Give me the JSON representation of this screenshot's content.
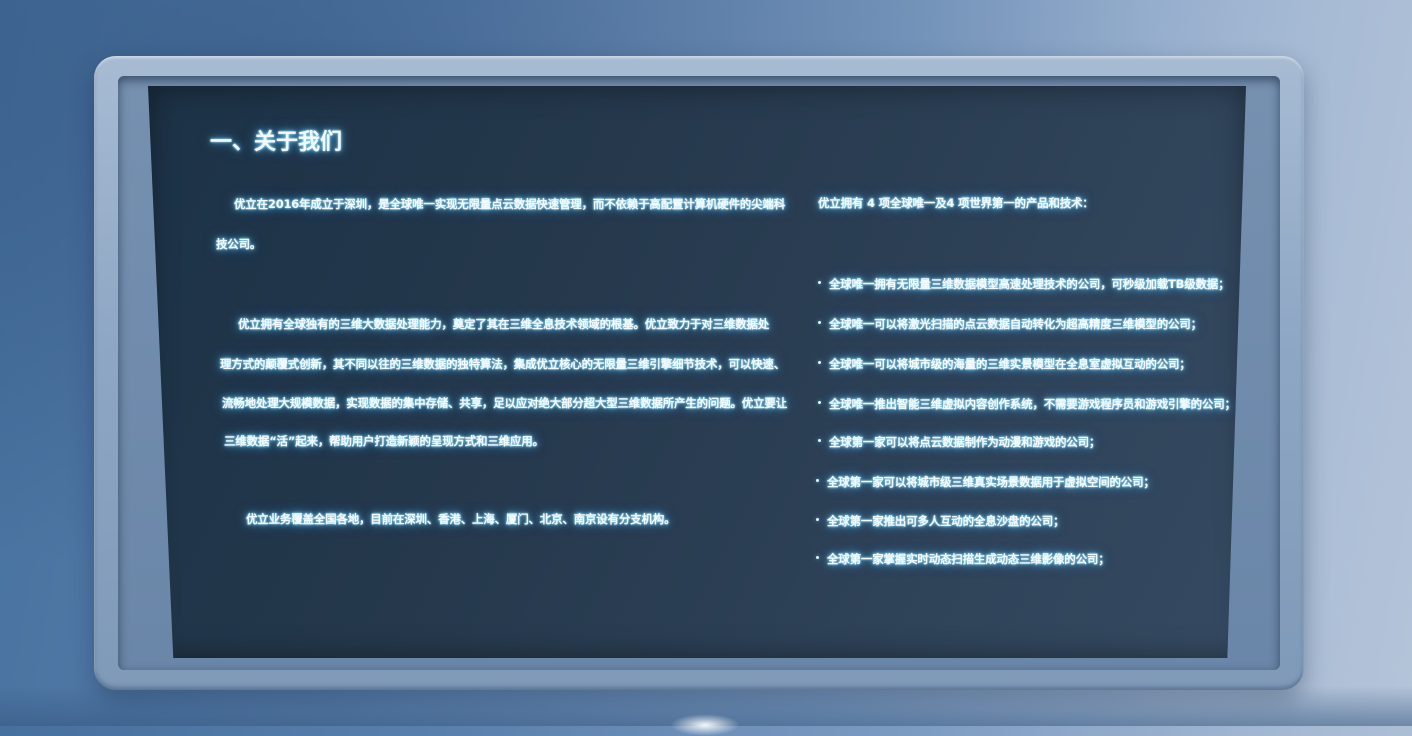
{
  "board": {
    "title": "一、关于我们",
    "left_lines": [
      "优立在2016年成立于深圳，是全球唯一实现无限量点云数据快速管理，而不依赖于高配置计算机硬件的尖端科",
      "技公司。",
      "优立拥有全球独有的三维大数据处理能力，奠定了其在三维全息技术领域的根基。优立致力于对三维数据处",
      "理方式的颠覆式创新，其不同以往的三维数据的独特算法，集成优立核心的无限量三维引擎细节技术，可以快速、",
      "流畅地处理大规模数据，实现数据的集中存储、共享，足以应对绝大部分超大型三维数据所产生的问题。优立要让",
      "三维数据“活”起来，帮助用户打造新颖的呈现方式和三维应用。",
      "优立业务覆盖全国各地，目前在深圳、香港、上海、厦门、北京、南京设有分支机构。"
    ],
    "right_heading": "优立拥有 4 项全球唯一及4 项世界第一的产品和技术：",
    "bullets": [
      "全球唯一拥有无限量三维数据模型高速处理技术的公司，可秒级加载TB级数据；",
      "全球唯一可以将激光扫描的点云数据自动转化为超高精度三维模型的公司；",
      "全球唯一可以将城市级的海量的三维实景模型在全息室虚拟互动的公司；",
      "全球唯一推出智能三维虚拟内容创作系统，不需要游戏程序员和游戏引擎的公司；",
      "全球第一家可以将点云数据制作为动漫和游戏的公司；",
      "全球第一家可以将城市级三维真实场景数据用于虚拟空间的公司；",
      "全球第一家推出可多人互动的全息沙盘的公司；",
      "全球第一家掌握实时动态扫描生成动态三维影像的公司；"
    ]
  },
  "colors": {
    "glow": "#5ecdff",
    "text": "#f1fbff",
    "screen": "#26394d",
    "frame": "#8ea7c4"
  }
}
